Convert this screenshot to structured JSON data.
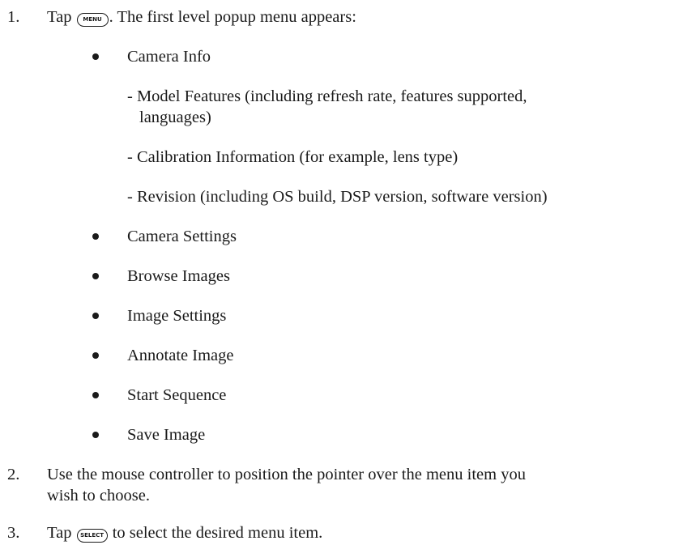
{
  "steps": [
    {
      "number": "1.",
      "prefix": "Tap ",
      "key": "MENU",
      "suffix": ". The first level popup menu appears:"
    },
    {
      "number": "2.",
      "text_line1": "Use the mouse controller to position the pointer over the menu item you",
      "text_line2": "wish to choose."
    },
    {
      "number": "3.",
      "prefix": "Tap ",
      "key": "SELECT",
      "suffix": " to select the desired menu item."
    }
  ],
  "menu": {
    "camera_info": "Camera Info",
    "sub_items": [
      {
        "line1": "- Model Features (including refresh rate, features supported,",
        "line2": "languages)"
      },
      {
        "line1": "- Calibration Information (for example, lens type)"
      },
      {
        "line1": "- Revision (including OS build, DSP version, software version)"
      }
    ],
    "items": [
      "Camera Settings",
      "Browse Images",
      "Image Settings",
      "Annotate Image",
      "Start Sequence",
      "Save Image"
    ]
  }
}
